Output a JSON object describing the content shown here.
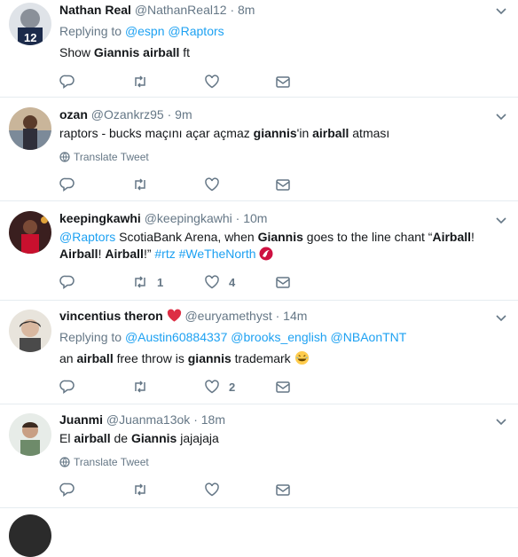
{
  "tweets": [
    {
      "name": "Nathan Real",
      "handle": "@NathanReal12",
      "time": "8m",
      "replying_prefix": "Replying to",
      "replying_to": [
        "@espn",
        "@Raptors"
      ],
      "text": [
        "Show ",
        "Giannis airball",
        " ft"
      ],
      "retweets": "",
      "likes": ""
    },
    {
      "name": "ozan",
      "handle": "@Ozankrz95",
      "time": "9m",
      "text": [
        "raptors - bucks maçını açar açmaz ",
        "giannis",
        "'in ",
        "airball",
        " atması"
      ],
      "translate": "Translate Tweet",
      "retweets": "",
      "likes": ""
    },
    {
      "name": "keepingkawhi",
      "handle": "@keepingkawhi",
      "time": "10m",
      "line1": [
        "@Raptors",
        " ScotiaBank Arena, when ",
        "Giannis",
        " goes to the line chant “",
        "Airball",
        "!"
      ],
      "line2": [
        "Airball",
        "! ",
        "Airball",
        "!” ",
        "#rtz",
        " ",
        "#WeTheNorth"
      ],
      "retweets": "1",
      "likes": "4"
    },
    {
      "name": "vincentius theron",
      "handle": "@euryamethyst",
      "time": "14m",
      "replying_prefix": "Replying to",
      "replying_to": [
        "@Austin60884337",
        "@brooks_english",
        "@NBAonTNT"
      ],
      "text": [
        "an ",
        "airball",
        " free throw is ",
        "giannis",
        " trademark"
      ],
      "retweets": "",
      "likes": "2"
    },
    {
      "name": "Juanmi",
      "handle": "@Juanma13ok",
      "time": "18m",
      "text": [
        "El ",
        "airball",
        " de ",
        "Giannis",
        " jajajaja"
      ],
      "translate": "Translate Tweet",
      "retweets": "",
      "likes": ""
    }
  ],
  "separator": "·",
  "colors": {
    "link": "#1da1f2",
    "muted": "#657786",
    "heart": "#e0245e"
  }
}
